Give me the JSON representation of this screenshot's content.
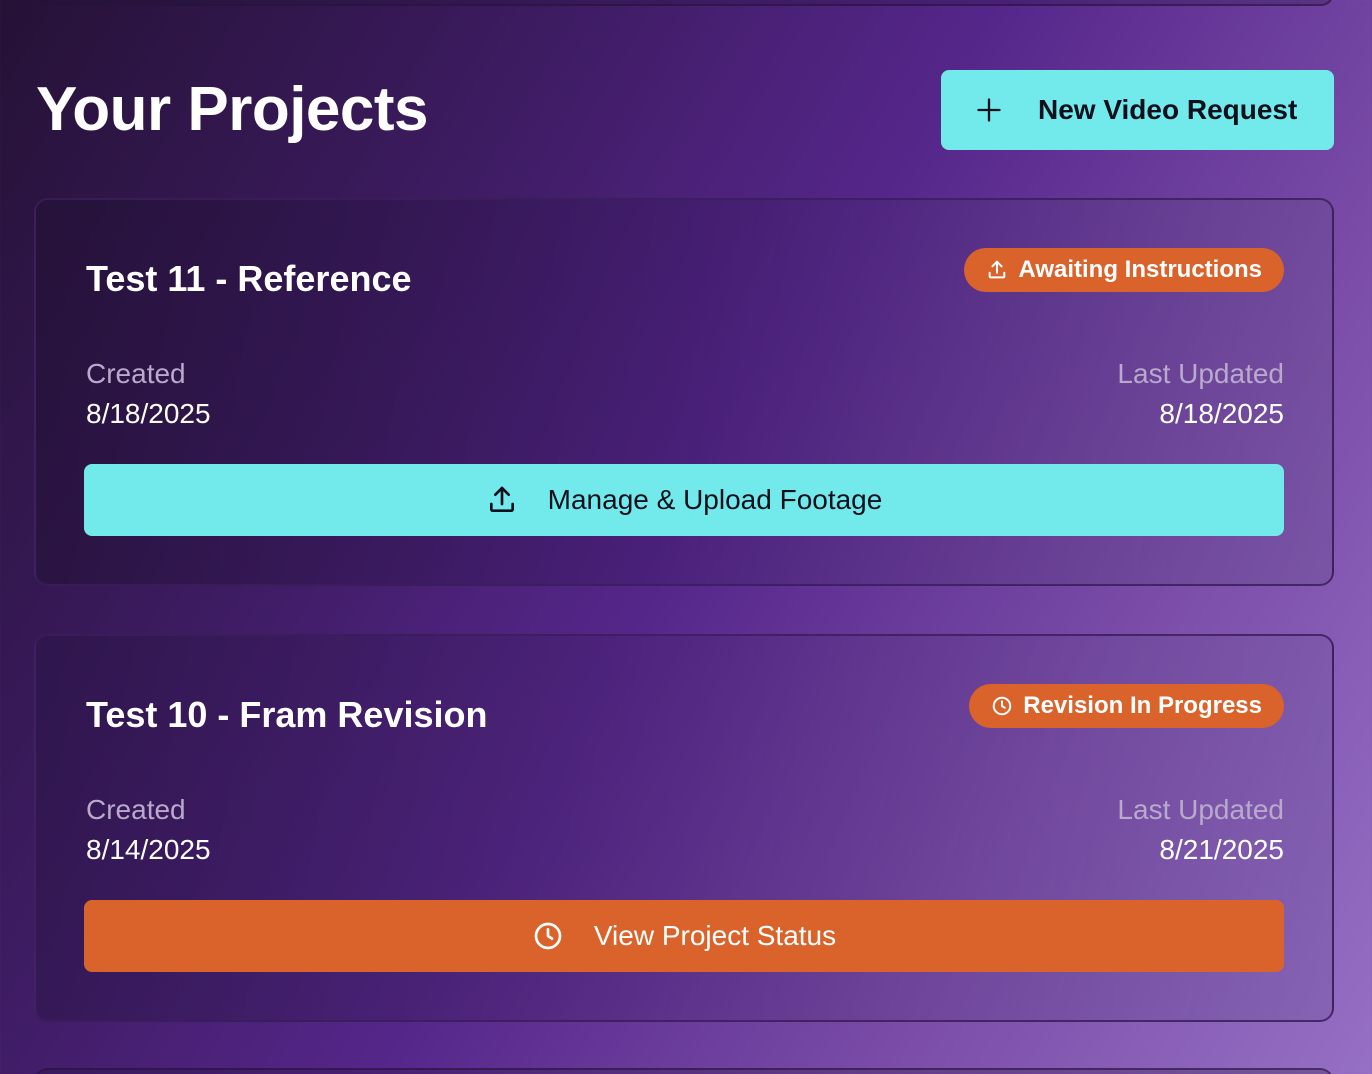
{
  "header": {
    "title": "Your Projects",
    "new_request_label": "New Video Request",
    "new_request_icon": "plus-icon"
  },
  "projects": [
    {
      "title": "Test 11 - Reference",
      "status": "Awaiting Instructions",
      "status_icon": "upload-icon",
      "status_color": "#d9632b",
      "created_label": "Created",
      "created": "8/18/2025",
      "updated_label": "Last Updated",
      "updated": "8/18/2025",
      "action_label": "Manage & Upload Footage",
      "action_icon": "upload-icon",
      "action_color": "#72eaec"
    },
    {
      "title": "Test 10 - Fram Revision",
      "status": "Revision In Progress",
      "status_icon": "clock-icon",
      "status_color": "#d9632b",
      "created_label": "Created",
      "created": "8/14/2025",
      "updated_label": "Last Updated",
      "updated": "8/21/2025",
      "action_label": "View Project Status",
      "action_icon": "clock-icon",
      "action_color": "#d9632b"
    }
  ],
  "colors": {
    "accent_cyan": "#72eaec",
    "accent_orange": "#d9632b",
    "muted_text": "#b9a9cc"
  }
}
